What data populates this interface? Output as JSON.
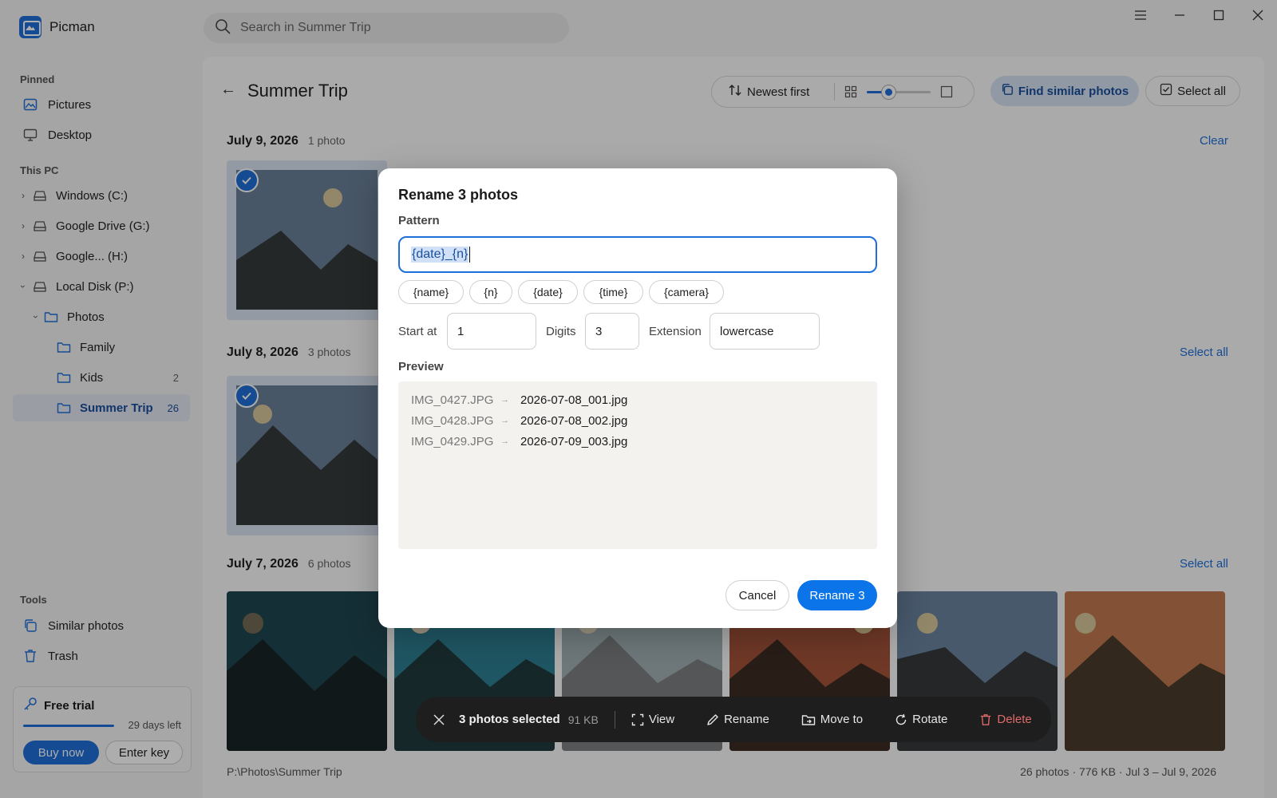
{
  "app": {
    "name": "Picman"
  },
  "search": {
    "placeholder": "Search in Summer Trip"
  },
  "sidebar": {
    "pinned_label": "Pinned",
    "pinned": [
      {
        "label": "Pictures",
        "icon": "image-icon"
      },
      {
        "label": "Desktop",
        "icon": "monitor-icon"
      }
    ],
    "thispc_label": "This PC",
    "drives": [
      {
        "label": "Windows (C:)"
      },
      {
        "label": "Google Drive (G:)"
      },
      {
        "label": "Google... (H:)"
      },
      {
        "label": "Local Disk (P:)"
      }
    ],
    "folders": [
      {
        "label": "Photos",
        "count": ""
      },
      {
        "label": "Family",
        "count": ""
      },
      {
        "label": "Kids",
        "count": "2"
      },
      {
        "label": "Summer Trip",
        "count": "26",
        "active": true
      }
    ],
    "tools_label": "Tools",
    "tools": [
      {
        "label": "Similar photos",
        "icon": "similar-icon"
      },
      {
        "label": "Trash",
        "icon": "trash-icon"
      }
    ],
    "trial": {
      "title": "Free trial",
      "days_left": "29 days left",
      "progress": 0.97,
      "buy_label": "Buy now",
      "key_label": "Enter key"
    }
  },
  "main": {
    "title": "Summer Trip",
    "sort_label": "Newest first",
    "thumb_size_level": 0.3,
    "find_similar_label": "Find similar photos",
    "select_all_label": "Select all",
    "groups": [
      {
        "date": "July 9, 2026",
        "count": "1 photo",
        "link": "Clear"
      },
      {
        "date": "July 8, 2026",
        "count": "3 photos",
        "link": "Select all"
      },
      {
        "date": "July 7, 2026",
        "count": "6 photos",
        "link": "Select all"
      }
    ],
    "status_path": "P:\\Photos\\Summer Trip",
    "status_summary": "26 photos · 776 KB · Jul 3 – Jul 9, 2026"
  },
  "dialog": {
    "title": "Rename 3 photos",
    "pattern_label": "Pattern",
    "pattern_value": "{date}_{n}",
    "tokens": [
      "{name}",
      "{n}",
      "{date}",
      "{time}",
      "{camera}"
    ],
    "start_label": "Start at",
    "start_value": "1",
    "digits_label": "Digits",
    "digits_value": "3",
    "extension_label": "Extension",
    "extension_value": "lowercase",
    "preview_label": "Preview",
    "preview": [
      {
        "old": "IMG_0427.JPG",
        "new": "2026-07-08_001.jpg"
      },
      {
        "old": "IMG_0428.JPG",
        "new": "2026-07-08_002.jpg"
      },
      {
        "old": "IMG_0429.JPG",
        "new": "2026-07-09_003.jpg"
      }
    ],
    "cancel_label": "Cancel",
    "rename_label": "Rename 3"
  },
  "action_bar": {
    "count": "3 photos selected",
    "size": "91 KB",
    "view": "View",
    "rename": "Rename",
    "move": "Move to",
    "rotate": "Rotate",
    "delete": "Delete"
  },
  "colors": {
    "accent": "#1e6fd9",
    "danger": "#e06a6a",
    "photo_palettes": {
      "slate": [
        "#6b8099",
        "#353a3c",
        "#d8c79a"
      ],
      "teal_dark": [
        "#1f4650",
        "#182426",
        "#736a58"
      ],
      "teal": [
        "#2f7f93",
        "#213a3f",
        "#e8dcc0"
      ],
      "grey": [
        "#a3b1b4",
        "#7c7f80",
        "#e8dcc0"
      ],
      "rust": [
        "#a4533a",
        "#3b2c22",
        "#e4cf98"
      ],
      "blue_grey": [
        "#6b83a0",
        "#35393b",
        "#d8c79a"
      ],
      "orange": [
        "#c27a50",
        "#4a3b2c",
        "#d8c79a"
      ]
    }
  }
}
